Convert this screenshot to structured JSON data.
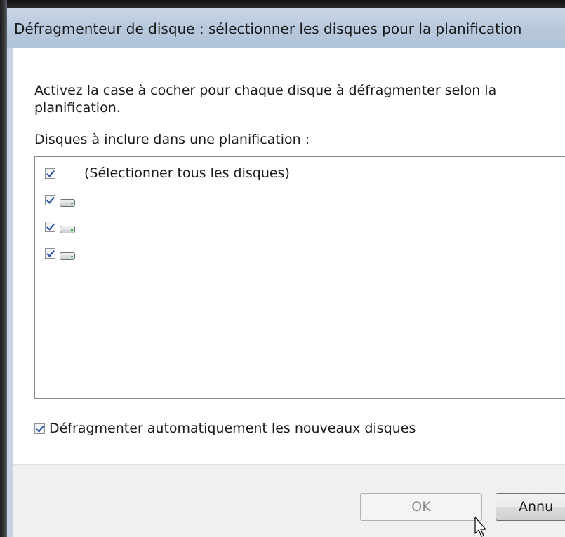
{
  "window": {
    "title": "Défragmenteur de disque : sélectionner les disques pour la planification"
  },
  "dialog": {
    "instruction": "Activez la case à cocher pour chaque disque à défragmenter selon la planification.",
    "list_label": "Disques à inclure dans une planification :",
    "list_items": [
      {
        "label": "(Sélectionner tous les disques)",
        "checked": true,
        "icon": ""
      },
      {
        "label": "",
        "checked": true,
        "icon": "hard-drive-icon"
      },
      {
        "label": "",
        "checked": true,
        "icon": "hard-drive-icon"
      },
      {
        "label": "",
        "checked": true,
        "icon": "hard-drive-icon"
      }
    ],
    "auto_defrag": {
      "label": "Défragmenter automatiquement les nouveaux disques",
      "checked": true
    }
  },
  "buttons": {
    "ok_label": "OK",
    "ok_enabled": false,
    "cancel_label": "Annu"
  },
  "colors": {
    "titlebar": "#b9c9dc",
    "checkmark": "#2a4fa6",
    "footer": "#f0f0f0"
  }
}
